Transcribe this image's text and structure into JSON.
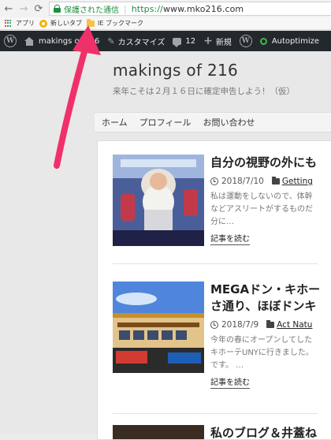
{
  "browser": {
    "back_icon": "arrow-left-icon",
    "forward_icon": "arrow-right-icon",
    "reload_icon": "reload-icon",
    "secure_label": "保護された通信",
    "url_scheme": "https://",
    "url_host": "www.mko216.com",
    "bookmarks": [
      {
        "label": "アプリ",
        "icon": "apps-icon"
      },
      {
        "label": "新しいタブ",
        "icon": "newtab-favicon"
      },
      {
        "label": "IE ブックマーク",
        "icon": "folder-icon"
      }
    ]
  },
  "adminbar": {
    "site_name": "makings of 216",
    "customize": "カスタマイズ",
    "comments_count": "12",
    "new_label": "新規",
    "autoptimize": "Autoptimize"
  },
  "site": {
    "title": "makings of 216",
    "description": "来年こそは２月１６日に確定申告しよう！（仮）"
  },
  "nav": {
    "items": [
      "ホーム",
      "プロフィール",
      "お問い合わせ"
    ]
  },
  "posts": [
    {
      "title": "自分の視野の外にも",
      "date": "2018/7/10",
      "category": "Getting",
      "excerpt": [
        "私は運動をしないので、体幹",
        "などアスリートがするものだ",
        "分に…"
      ],
      "read_more": "記事を読む"
    },
    {
      "title_lines": [
        "MEGAドン・キホー",
        "さ通り、ほぼドンキ"
      ],
      "date": "2018/7/9",
      "category": "Act Natu",
      "excerpt": [
        "今年の春にオープンしてした",
        "キホーテUNYに行きました。",
        "です。 …"
      ],
      "read_more": "記事を読む"
    },
    {
      "title": "私のブログ＆井蓋ね"
    }
  ],
  "colors": {
    "adminbar_bg": "#23282d",
    "annotation_arrow": "#f0306a"
  }
}
